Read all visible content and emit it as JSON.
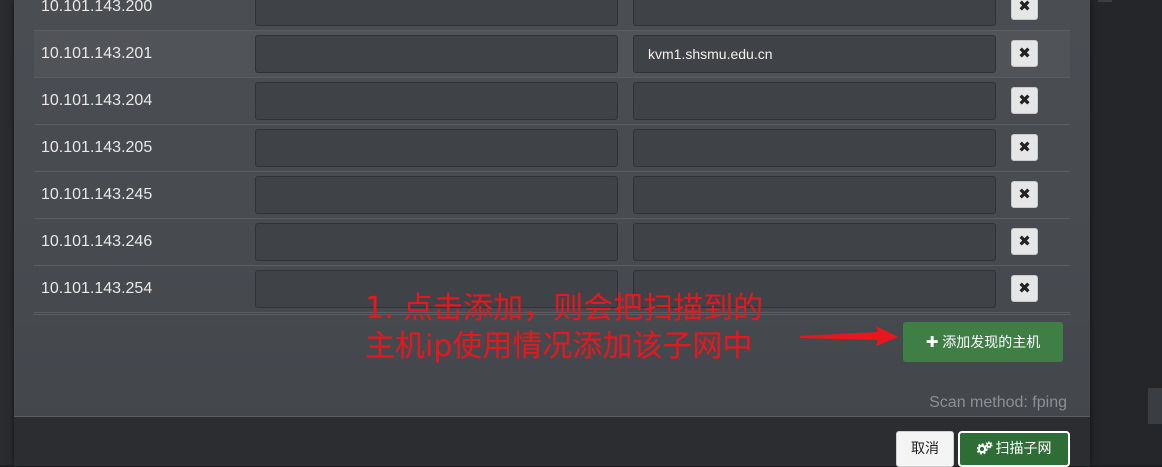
{
  "hosts": [
    {
      "ip": "10.101.143.200",
      "description": "",
      "hostname": ""
    },
    {
      "ip": "10.101.143.201",
      "description": "",
      "hostname": "kvm1.shsmu.edu.cn"
    },
    {
      "ip": "10.101.143.204",
      "description": "",
      "hostname": ""
    },
    {
      "ip": "10.101.143.205",
      "description": "",
      "hostname": ""
    },
    {
      "ip": "10.101.143.245",
      "description": "",
      "hostname": ""
    },
    {
      "ip": "10.101.143.246",
      "description": "",
      "hostname": ""
    },
    {
      "ip": "10.101.143.254",
      "description": "",
      "hostname": ""
    }
  ],
  "delete_glyph": "✖",
  "annotation": {
    "line1": "1. 点击添加，则会把扫描到的",
    "line2": "主机ip使用情况添加该子网中",
    "color": "#e8171d"
  },
  "add_button": {
    "icon": "plus-icon",
    "label": "添加发现的主机"
  },
  "scan_method": "Scan method: fping",
  "footer": {
    "cancel_label": "取消",
    "scan_label": "扫描子网",
    "scan_icon": "gears-icon"
  }
}
